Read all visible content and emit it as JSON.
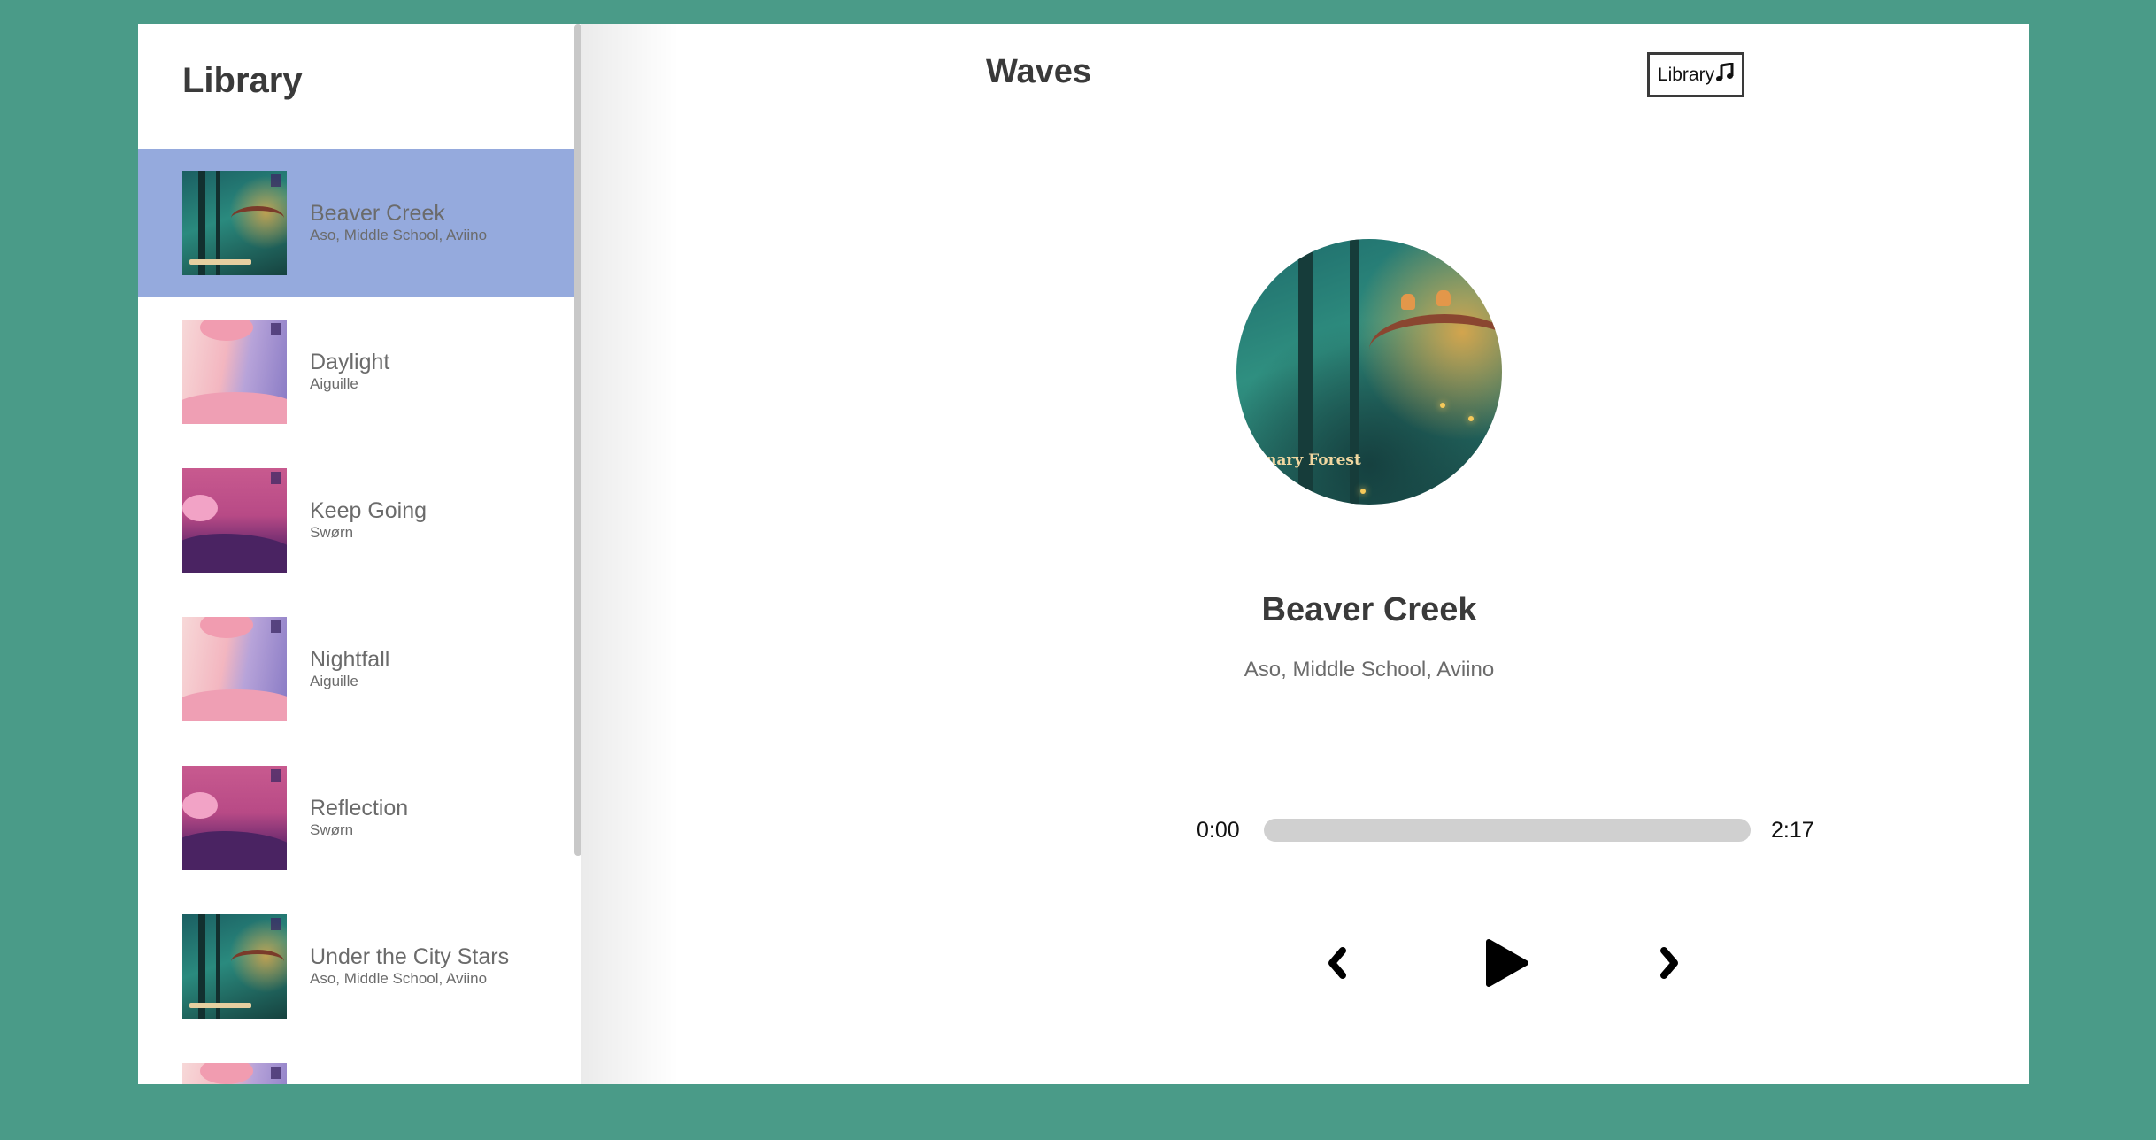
{
  "library": {
    "title": "Library",
    "songs": [
      {
        "name": "Beaver Creek",
        "artist": "Aso, Middle School, Aviino",
        "selected": true,
        "cover": "canary-forest-cover"
      },
      {
        "name": "Daylight",
        "artist": "Aiguille",
        "selected": false,
        "cover": "pink-sky-cover"
      },
      {
        "name": "Keep Going",
        "artist": "Swørn",
        "selected": false,
        "cover": "magenta-lake-cover"
      },
      {
        "name": "Nightfall",
        "artist": "Aiguille",
        "selected": false,
        "cover": "pink-sky-cover"
      },
      {
        "name": "Reflection",
        "artist": "Swørn",
        "selected": false,
        "cover": "magenta-lake-cover"
      },
      {
        "name": "Under the City Stars",
        "artist": "Aso, Middle School, Aviino",
        "selected": false,
        "cover": "canary-forest-cover"
      }
    ]
  },
  "header": {
    "brand": "Waves",
    "library_button": "Library",
    "library_button_icon": "music-note-icon"
  },
  "now_playing": {
    "title": "Beaver Creek",
    "artist": "Aso, Middle School, Aviino",
    "art_caption": "anary Forest",
    "current_time": "0:00",
    "total_time": "2:17",
    "progress": 0
  },
  "controls": {
    "prev_icon": "chevron-left-icon",
    "play_icon": "play-icon",
    "next_icon": "chevron-right-icon"
  },
  "colors": {
    "background": "#4a9b88",
    "selected_row": "#95aadd",
    "track_bar": "#d0d0d0"
  }
}
